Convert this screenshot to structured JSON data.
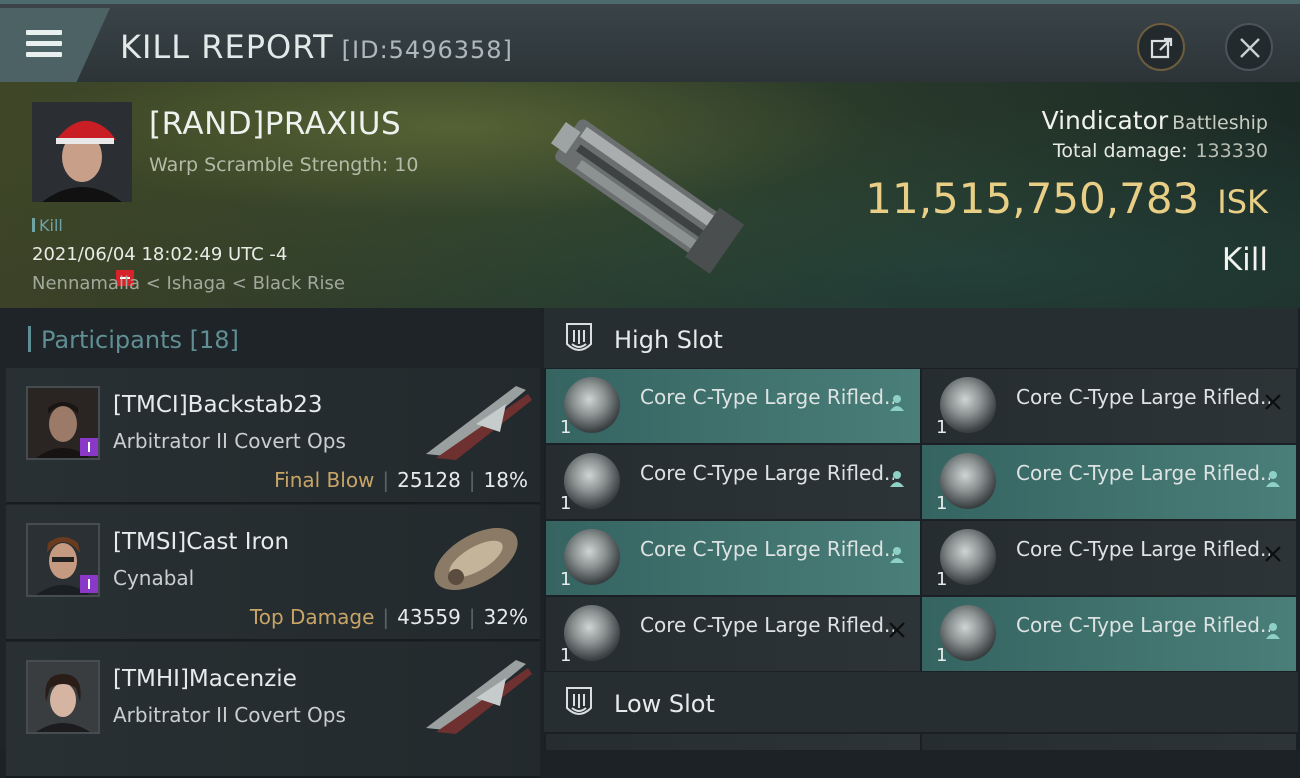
{
  "header": {
    "title": "KILL REPORT",
    "report_id": "[ID:5496358]"
  },
  "victim": {
    "name": "[RAND]PRAXIUS",
    "warp_scramble": "Warp Scramble Strength: 10",
    "kill_tag": "Kill",
    "time": "2021/06/04 18:02:49 UTC -4",
    "location": "Nennamaila < Ishaga < Black Rise",
    "ship_name": "Vindicator",
    "ship_class": "Battleship",
    "total_damage_label": "Total damage:",
    "total_damage": "133330",
    "isk_value": "11,515,750,783",
    "isk_unit": "ISK",
    "outcome": "Kill"
  },
  "participants": {
    "label": "Participants",
    "count": "[18]",
    "rows": [
      {
        "name": "[TMCI]Backstab23",
        "ship": "Arbitrator II Covert Ops",
        "tag": "Final Blow",
        "damage": "25128",
        "percent": "18%"
      },
      {
        "name": "[TMSI]Cast Iron",
        "ship": "Cynabal",
        "tag": "Top Damage",
        "damage": "43559",
        "percent": "32%"
      },
      {
        "name": "[TMHI]Macenzie",
        "ship": "Arbitrator II Covert Ops",
        "tag": "",
        "damage": "",
        "percent": ""
      }
    ]
  },
  "fitting": {
    "high_slot_label": "High Slot",
    "low_slot_label": "Low Slot",
    "modules": [
      {
        "name": "Core C-Type Large Rifled...",
        "qty": "1",
        "status": "dropped"
      },
      {
        "name": "Core C-Type Large Rifled...",
        "qty": "1",
        "status": "destroyed"
      },
      {
        "name": "Core C-Type Large Rifled...",
        "qty": "1",
        "status": "dropped"
      },
      {
        "name": "Core C-Type Large Rifled...",
        "qty": "1",
        "status": "dropped"
      },
      {
        "name": "Core C-Type Large Rifled...",
        "qty": "1",
        "status": "dropped"
      },
      {
        "name": "Core C-Type Large Rifled...",
        "qty": "1",
        "status": "destroyed"
      },
      {
        "name": "Core C-Type Large Rifled...",
        "qty": "1",
        "status": "destroyed"
      },
      {
        "name": "Core C-Type Large Rifled...",
        "qty": "1",
        "status": "dropped"
      }
    ]
  },
  "colors": {
    "accent_teal": "#5f8f95",
    "isk_gold": "#e9cf85",
    "dropped_green": "#4a7e79",
    "final_blow_gold": "#c8a567"
  }
}
